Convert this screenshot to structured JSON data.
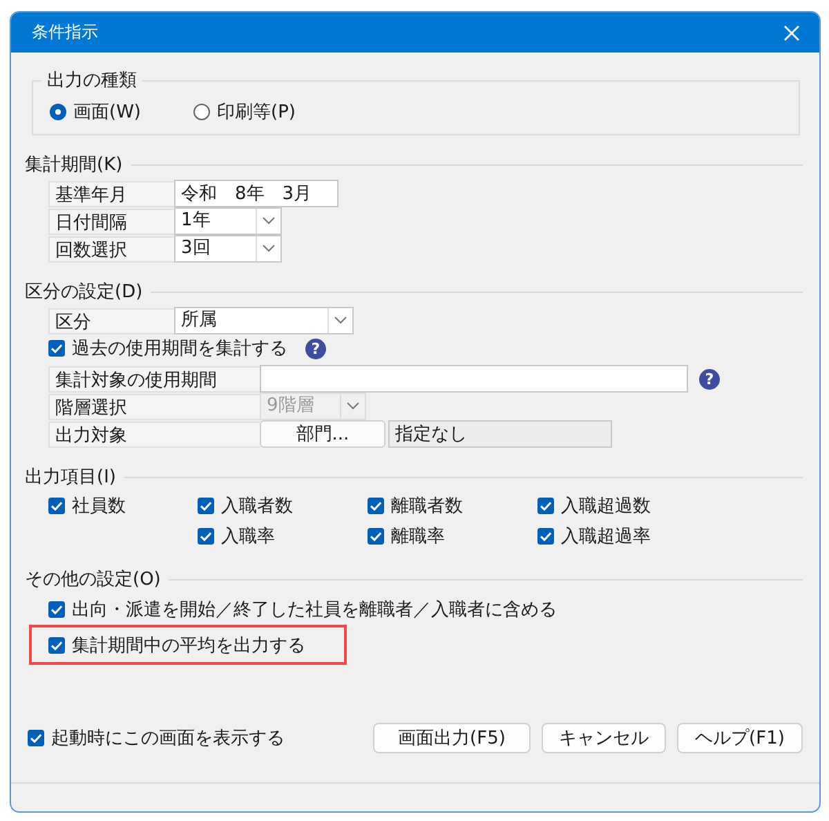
{
  "window": {
    "title": "条件指示"
  },
  "output_type": {
    "legend": "出力の種類",
    "options": [
      {
        "label": "画面(W)",
        "selected": true
      },
      {
        "label": "印刷等(P)",
        "selected": false
      }
    ]
  },
  "period": {
    "heading": "集計期間(K)",
    "rows": [
      {
        "kind": "text",
        "label": "基準年月",
        "value": "令和　8年　3月"
      },
      {
        "kind": "dropdown",
        "label": "日付間隔",
        "value": "1年"
      },
      {
        "kind": "dropdown",
        "label": "回数選択",
        "value": "3回"
      }
    ]
  },
  "division": {
    "heading": "区分の設定(D)",
    "category": {
      "label": "区分",
      "value": "所属"
    },
    "past_period": {
      "label": "過去の使用期間を集計する",
      "checked": true,
      "help": "?"
    },
    "target_period": {
      "label": "集計対象の使用期間",
      "help": "?"
    },
    "level": {
      "label": "階層選択",
      "value": "9階層",
      "disabled": true
    },
    "output_target": {
      "label": "出力対象",
      "button": "部門...",
      "value": "指定なし"
    }
  },
  "output_items": {
    "heading": "出力項目(I)",
    "rows": [
      [
        {
          "label": "社員数",
          "checked": true
        },
        {
          "label": "入職者数",
          "checked": true
        },
        {
          "label": "離職者数",
          "checked": true
        },
        {
          "label": "入職超過数",
          "checked": true
        }
      ],
      [
        null,
        {
          "label": "入職率",
          "checked": true
        },
        {
          "label": "離職率",
          "checked": true
        },
        {
          "label": "入職超過率",
          "checked": true
        }
      ]
    ]
  },
  "other": {
    "heading": "その他の設定(O)",
    "options": [
      {
        "label": "出向・派遣を開始／終了した社員を離職者／入職者に含める",
        "checked": true,
        "highlighted": false
      },
      {
        "label": "集計期間中の平均を出力する",
        "checked": true,
        "highlighted": true
      }
    ]
  },
  "startup": {
    "label": "起動時にこの画面を表示する",
    "checked": true
  },
  "buttons": [
    "画面出力(F5)",
    "キャンセル",
    "ヘルプ(F1)"
  ]
}
